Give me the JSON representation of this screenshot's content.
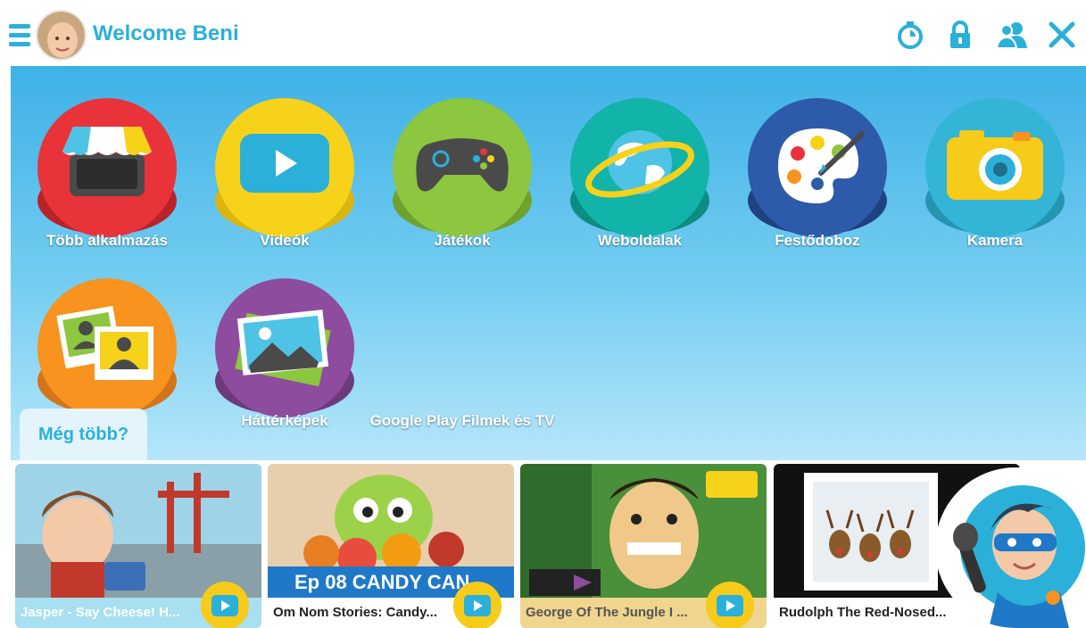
{
  "header": {
    "welcome": "Welcome Beni",
    "icons": [
      "timer-icon",
      "lock-icon",
      "parents-icon",
      "close-icon"
    ],
    "accent": "#2bb0d9"
  },
  "apps": [
    {
      "label": "Több alkalmazás",
      "color": "#e8333a",
      "icon": "store-icon"
    },
    {
      "label": "Videók",
      "color": "#f6d21b",
      "icon": "video-play-icon"
    },
    {
      "label": "Játékok",
      "color": "#8dc63f",
      "icon": "gamepad-icon"
    },
    {
      "label": "Weboldalak",
      "color": "#12b3a8",
      "icon": "globe-icon"
    },
    {
      "label": "Festődoboz",
      "color": "#2d5ba9",
      "icon": "paint-palette-icon"
    },
    {
      "label": "Kamera",
      "color": "#34b4d6",
      "icon": "camera-icon"
    },
    {
      "label": "",
      "color": "#f7931e",
      "icon": "photos-icon"
    },
    {
      "label": "Háttérképek",
      "color": "#8e4c9e",
      "icon": "wallpaper-icon"
    },
    {
      "label": "Google Play Filmek és TV",
      "color": "",
      "icon": ""
    }
  ],
  "more_tab": "Még több?",
  "videos": [
    {
      "title": "Jasper - Say Cheese! H...",
      "bar_color": "#a8dff1",
      "text_color": "#ffffff"
    },
    {
      "title": "Om Nom Stories: Candy...",
      "bar_color": "#ffffff",
      "text_color": "#222222",
      "overlay": "Ep 08 CANDY CAN"
    },
    {
      "title": "George Of The Jungle I ...",
      "bar_color": "#efd58e",
      "text_color": "#555555"
    },
    {
      "title": "Rudolph The Red-Nosed...",
      "bar_color": "#ffffff",
      "text_color": "#222222"
    }
  ]
}
